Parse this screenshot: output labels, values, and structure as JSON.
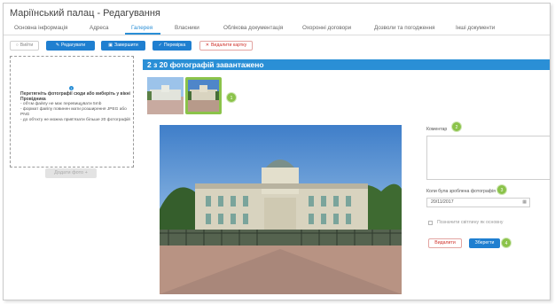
{
  "window": {
    "title": "Маріїнський палац - Редагування"
  },
  "tabs": [
    {
      "label": "Основна інформація"
    },
    {
      "label": "Адреса"
    },
    {
      "label": "Галерея",
      "active": true
    },
    {
      "label": "Власники"
    },
    {
      "label": "Облікова документація"
    },
    {
      "label": "Охоронні договори"
    },
    {
      "label": "Дозволи та погодження"
    },
    {
      "label": "Інші документи"
    }
  ],
  "toolbar": {
    "exit_label": "Вийти",
    "edit_label": "Редагувати",
    "save_label": "Завершити",
    "check_label": "Перевірка",
    "delete_card_label": "Видалити картку"
  },
  "dropzone": {
    "heading": "Перетягніть фотографії сюди або виберіть у вікні Провідника",
    "lines": [
      "- об'єм файлу не має перевищувати 5mb",
      "- формат файлу повинен мати розширення JPEG або PNG",
      "- до об'єкту не можна прив'язати більше 20 фотографій"
    ],
    "add_button": "Додати фото +"
  },
  "gallery": {
    "counter_text": "2 з 20 фотографій завантажено"
  },
  "markers": [
    "1",
    "2",
    "3",
    "4"
  ],
  "form": {
    "comment_label": "Коментар",
    "date_label": "Коли була зроблена фотографія",
    "date_value": "20/11/2017",
    "main_photo_label": "Позначити світлину як основну",
    "delete_label": "Видалити",
    "save_label": "Зберегти"
  },
  "colors": {
    "accent": "#2a8fd6",
    "marker": "#8bc34a",
    "danger": "#d0302a"
  },
  "icons": [
    "calendar-icon",
    "pencil-icon",
    "check-icon",
    "close-icon",
    "info-icon"
  ]
}
